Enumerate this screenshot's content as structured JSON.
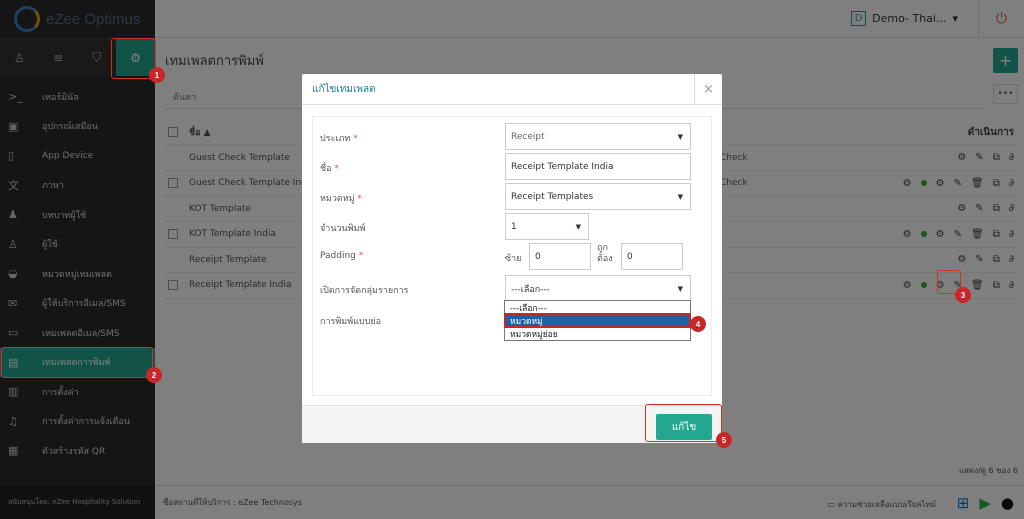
{
  "app": {
    "logo_text": "eZee Optimus",
    "sidebar_footer": "สนับสนุนโดย: eZee Hospitality Solution"
  },
  "topbar": {
    "property_badge": "D",
    "property_name": "Demo- Thai...",
    "caret": "▾"
  },
  "sidebar": {
    "icons": [
      "user-icon",
      "list-icon",
      "store-icon",
      "gear-icon"
    ],
    "items": [
      {
        "label": "เทอร์มินัล",
        "icon": "terminal-icon",
        "glyph": ">_"
      },
      {
        "label": "อุปกรณ์เสมือน",
        "icon": "device-icon",
        "glyph": "▣"
      },
      {
        "label": "App Device",
        "icon": "tablet-icon",
        "glyph": "▯"
      },
      {
        "label": "ภาษา",
        "icon": "language-icon",
        "glyph": "文"
      },
      {
        "label": "บทบาทผู้ใช้",
        "icon": "user-role-icon",
        "glyph": "♟"
      },
      {
        "label": "ผู้ใช้",
        "icon": "user-icon",
        "glyph": "♙"
      },
      {
        "label": "หมวดหมู่เทมเพลต",
        "icon": "template-category-icon",
        "glyph": "◒"
      },
      {
        "label": "ผู้ให้บริการอีเมล/SMS",
        "icon": "mail-icon",
        "glyph": "✉"
      },
      {
        "label": "เทมเพลตอีเมล/SMS",
        "icon": "email-template-icon",
        "glyph": "▭"
      },
      {
        "label": "เทมเพลตการพิมพ์",
        "icon": "print-template-icon",
        "glyph": "▤"
      },
      {
        "label": "การตั้งค่า",
        "icon": "settings-icon",
        "glyph": "▥"
      },
      {
        "label": "การตั้งค่าการแจ้งเตือน",
        "icon": "bell-icon",
        "glyph": "♫"
      },
      {
        "label": "ตัวสร้างรหัส QR",
        "icon": "qr-icon",
        "glyph": "▦"
      }
    ],
    "active_index": 9
  },
  "page": {
    "title": "เทมเพลตการพิมพ์",
    "add_label": "+",
    "more_label": "•••",
    "search_label": "ค้นหา",
    "columns": {
      "name": "ชื่อ ▲",
      "action": "ดำเนินการ"
    },
    "rows": [
      {
        "name": "Guest Check Template",
        "category": "Check",
        "checkbox": false
      },
      {
        "name": "Guest Check Template India",
        "category": "Check",
        "checkbox": true
      },
      {
        "name": "KOT Template",
        "category": "",
        "checkbox": false
      },
      {
        "name": "KOT Template India",
        "category": "",
        "checkbox": true
      },
      {
        "name": "Receipt Template",
        "category": "",
        "checkbox": false
      },
      {
        "name": "Receipt Template India",
        "category": "",
        "checkbox": true
      }
    ],
    "pager": "แสดง/ดู 6 ของ 6",
    "footer_text": "ชื่อสถานที่ให้บริการ : eZee Technosys",
    "support_text": "ความช่วยเหลือแบบเรียลไทม์"
  },
  "modal": {
    "title": "แก้ไขเทมเพลต",
    "close": "×",
    "fields": {
      "type_label": "ประเภท",
      "type_value": "Receipt",
      "name_label": "ชื่อ",
      "name_value": "Receipt Template India",
      "category_label": "หมวดหมู่",
      "category_value": "Receipt Templates",
      "copies_label": "จำนวนพิมพ์",
      "copies_value": "1",
      "padding_label": "Padding",
      "left_label": "ซ้าย",
      "left_value": "0",
      "right_label": "ถูกต้อง",
      "right_value": "0",
      "grouping_label": "เปิดการจัดกลุ่มรายการ",
      "grouping_value": "---เลือก---",
      "compact_label": "การพิมพ์แบบย่อ",
      "required_mark": "*"
    },
    "dropdown_options": [
      "---เลือก---",
      "หมวดหมู่",
      "หมวดหมู่ย่อย"
    ],
    "dropdown_selected": 1,
    "save_label": "แก้ไข"
  },
  "callouts": [
    "1",
    "2",
    "3",
    "4",
    "5"
  ],
  "colors": {
    "accent": "#23a88f",
    "sidebar": "#2b2b2b",
    "callout": "#c62828",
    "modal_title": "#1f7a9c"
  }
}
